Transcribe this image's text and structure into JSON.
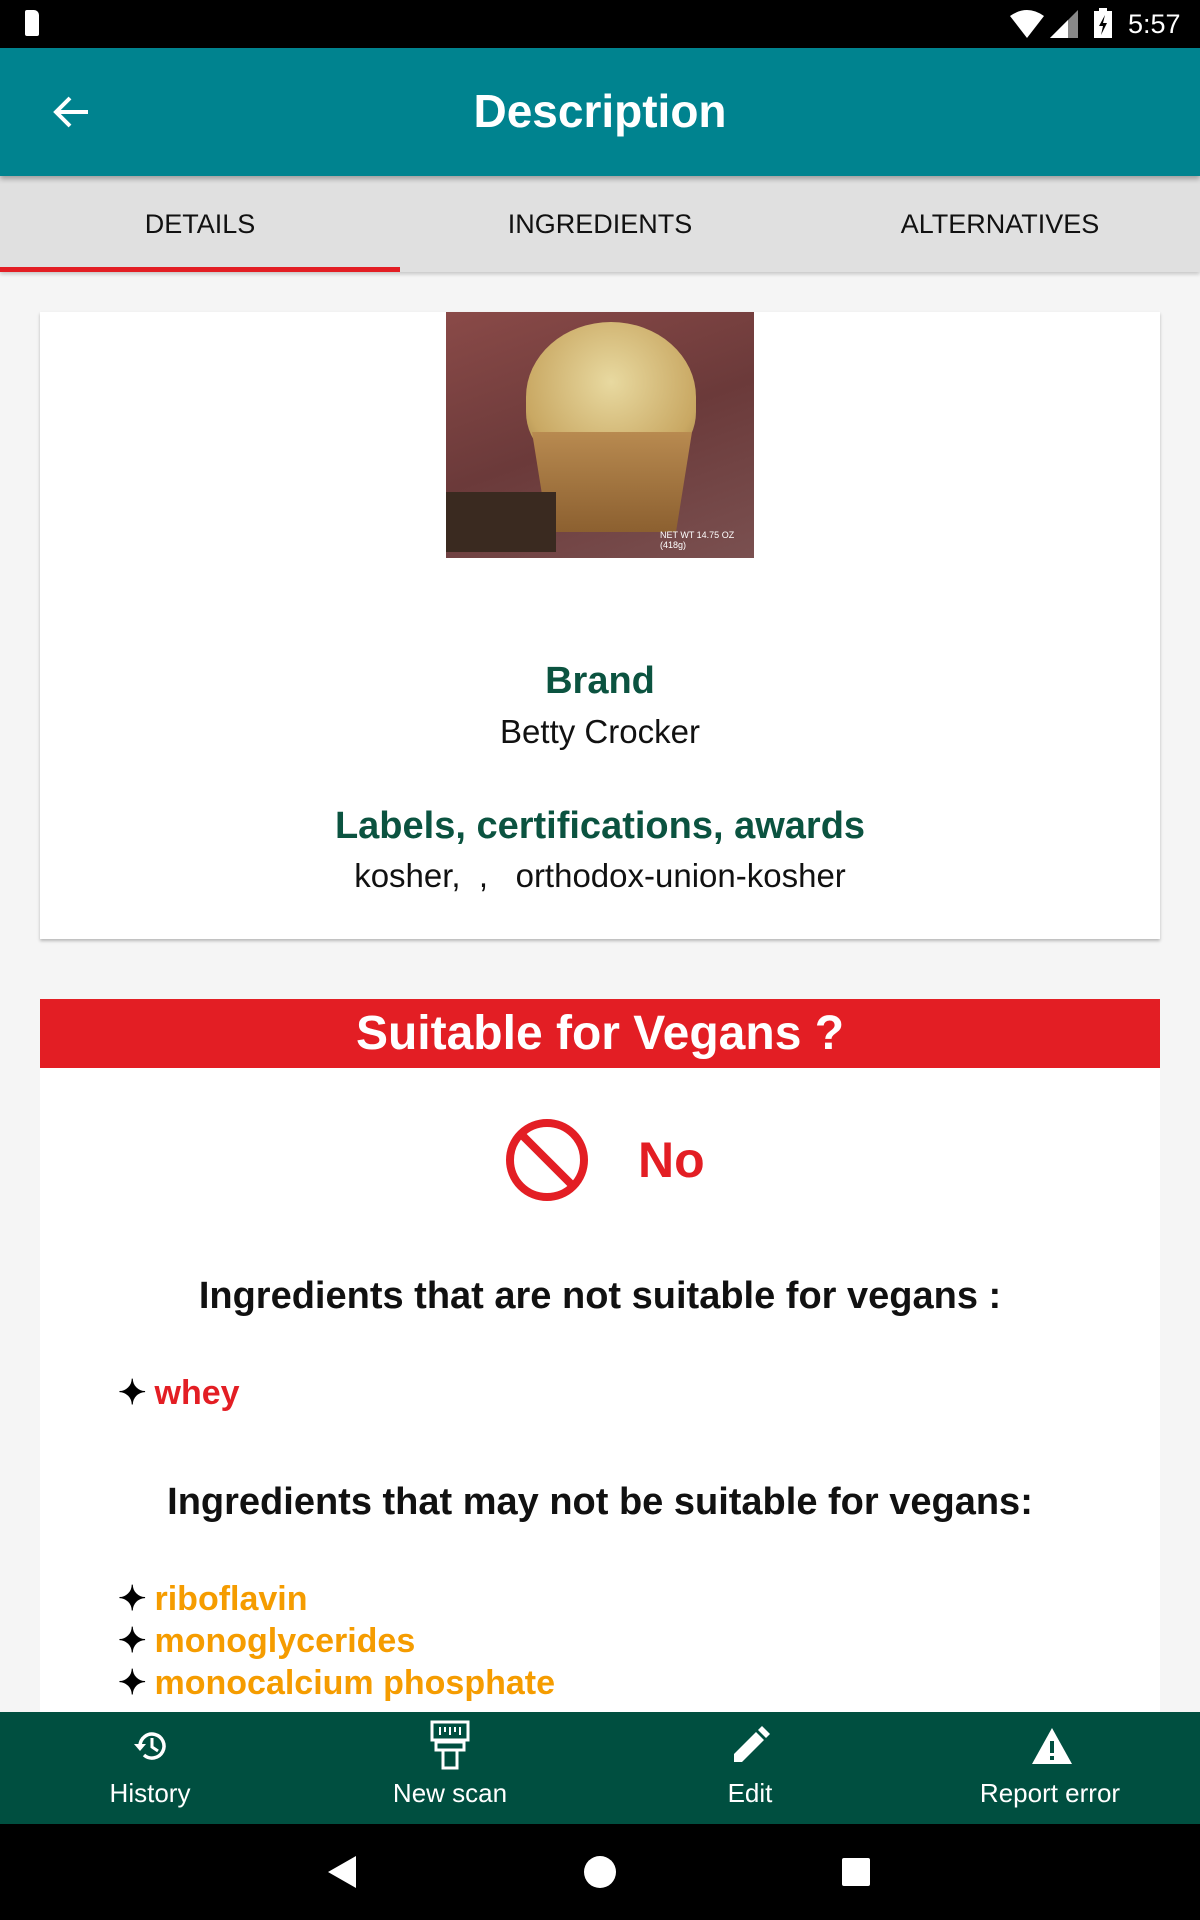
{
  "status_bar": {
    "time": "5:57",
    "icons": [
      "sd-card-icon",
      "wifi-icon",
      "signal-icon",
      "battery-charging-icon"
    ]
  },
  "app_bar": {
    "title": "Description",
    "back_icon": "arrow-left-icon"
  },
  "tabs": [
    {
      "label": "DETAILS",
      "selected": true
    },
    {
      "label": "INGREDIENTS",
      "selected": false
    },
    {
      "label": "ALTERNATIVES",
      "selected": false
    }
  ],
  "product": {
    "image_alt": "Product photo of chocolate chip muffin mix box",
    "image_text": "NET WT 14.75 OZ (418g)",
    "brand_label": "Brand",
    "brand": "Betty Crocker",
    "labels_label": "Labels, certifications, awards",
    "labels": "kosher,  ,   orthodox-union-kosher"
  },
  "vegan": {
    "title": "Suitable for Vegans ?",
    "verdict": "No",
    "verdict_icon": "prohibited-icon",
    "not_suitable_heading": "Ingredients that are not suitable for vegans :",
    "not_suitable": [
      "whey"
    ],
    "maybe_heading": "Ingredients that may not be suitable for vegans:",
    "maybe": [
      "riboflavin",
      "monoglycerides",
      "monocalcium phosphate"
    ],
    "bullet": "✦"
  },
  "colors": {
    "app_bar": "#00838f",
    "tab_indicator": "#e31e24",
    "heading": "#0b5340",
    "not_suitable": "#e31e24",
    "maybe": "#f59c00",
    "bottom_nav": "#004f40"
  },
  "bottom_nav": [
    {
      "label": "History",
      "icon": "history-icon"
    },
    {
      "label": "New scan",
      "icon": "barcode-scanner-icon"
    },
    {
      "label": "Edit",
      "icon": "pencil-icon"
    },
    {
      "label": "Report error",
      "icon": "warning-icon"
    }
  ]
}
